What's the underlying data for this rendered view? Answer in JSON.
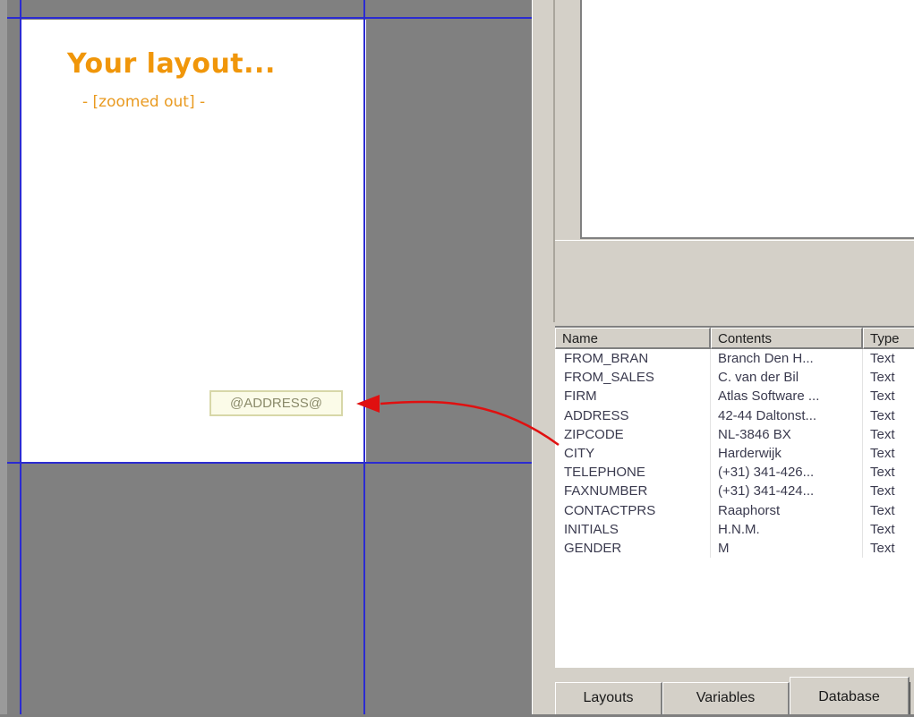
{
  "canvas": {
    "title": "Your layout...",
    "subtitle": "- [zoomed out] -",
    "field_tag": "@ADDRESS@"
  },
  "table": {
    "columns": [
      "Name",
      "Contents",
      "Type"
    ],
    "rows": [
      [
        "FROM_BRAN",
        "Branch Den H...",
        "Text"
      ],
      [
        "FROM_SALES",
        "C. van der Bil",
        "Text"
      ],
      [
        "FIRM",
        "Atlas Software ...",
        "Text"
      ],
      [
        "ADDRESS",
        "42-44 Daltonst...",
        "Text"
      ],
      [
        "ZIPCODE",
        "NL-3846 BX",
        "Text"
      ],
      [
        "CITY",
        "Harderwijk",
        "Text"
      ],
      [
        "TELEPHONE",
        "(+31) 341-426...",
        "Text"
      ],
      [
        "FAXNUMBER",
        "(+31) 341-424...",
        "Text"
      ],
      [
        "CONTACTPRS",
        "Raaphorst",
        "Text"
      ],
      [
        "INITIALS",
        "H.N.M.",
        "Text"
      ],
      [
        "GENDER",
        "M",
        "Text"
      ]
    ]
  },
  "tabs": [
    {
      "label": "Layouts",
      "active": false
    },
    {
      "label": "Variables",
      "active": false
    },
    {
      "label": "Database",
      "active": true
    }
  ],
  "colors": {
    "title": "#f0960a",
    "guide_lines": "#2b2bd1",
    "arrow": "#e01010"
  }
}
